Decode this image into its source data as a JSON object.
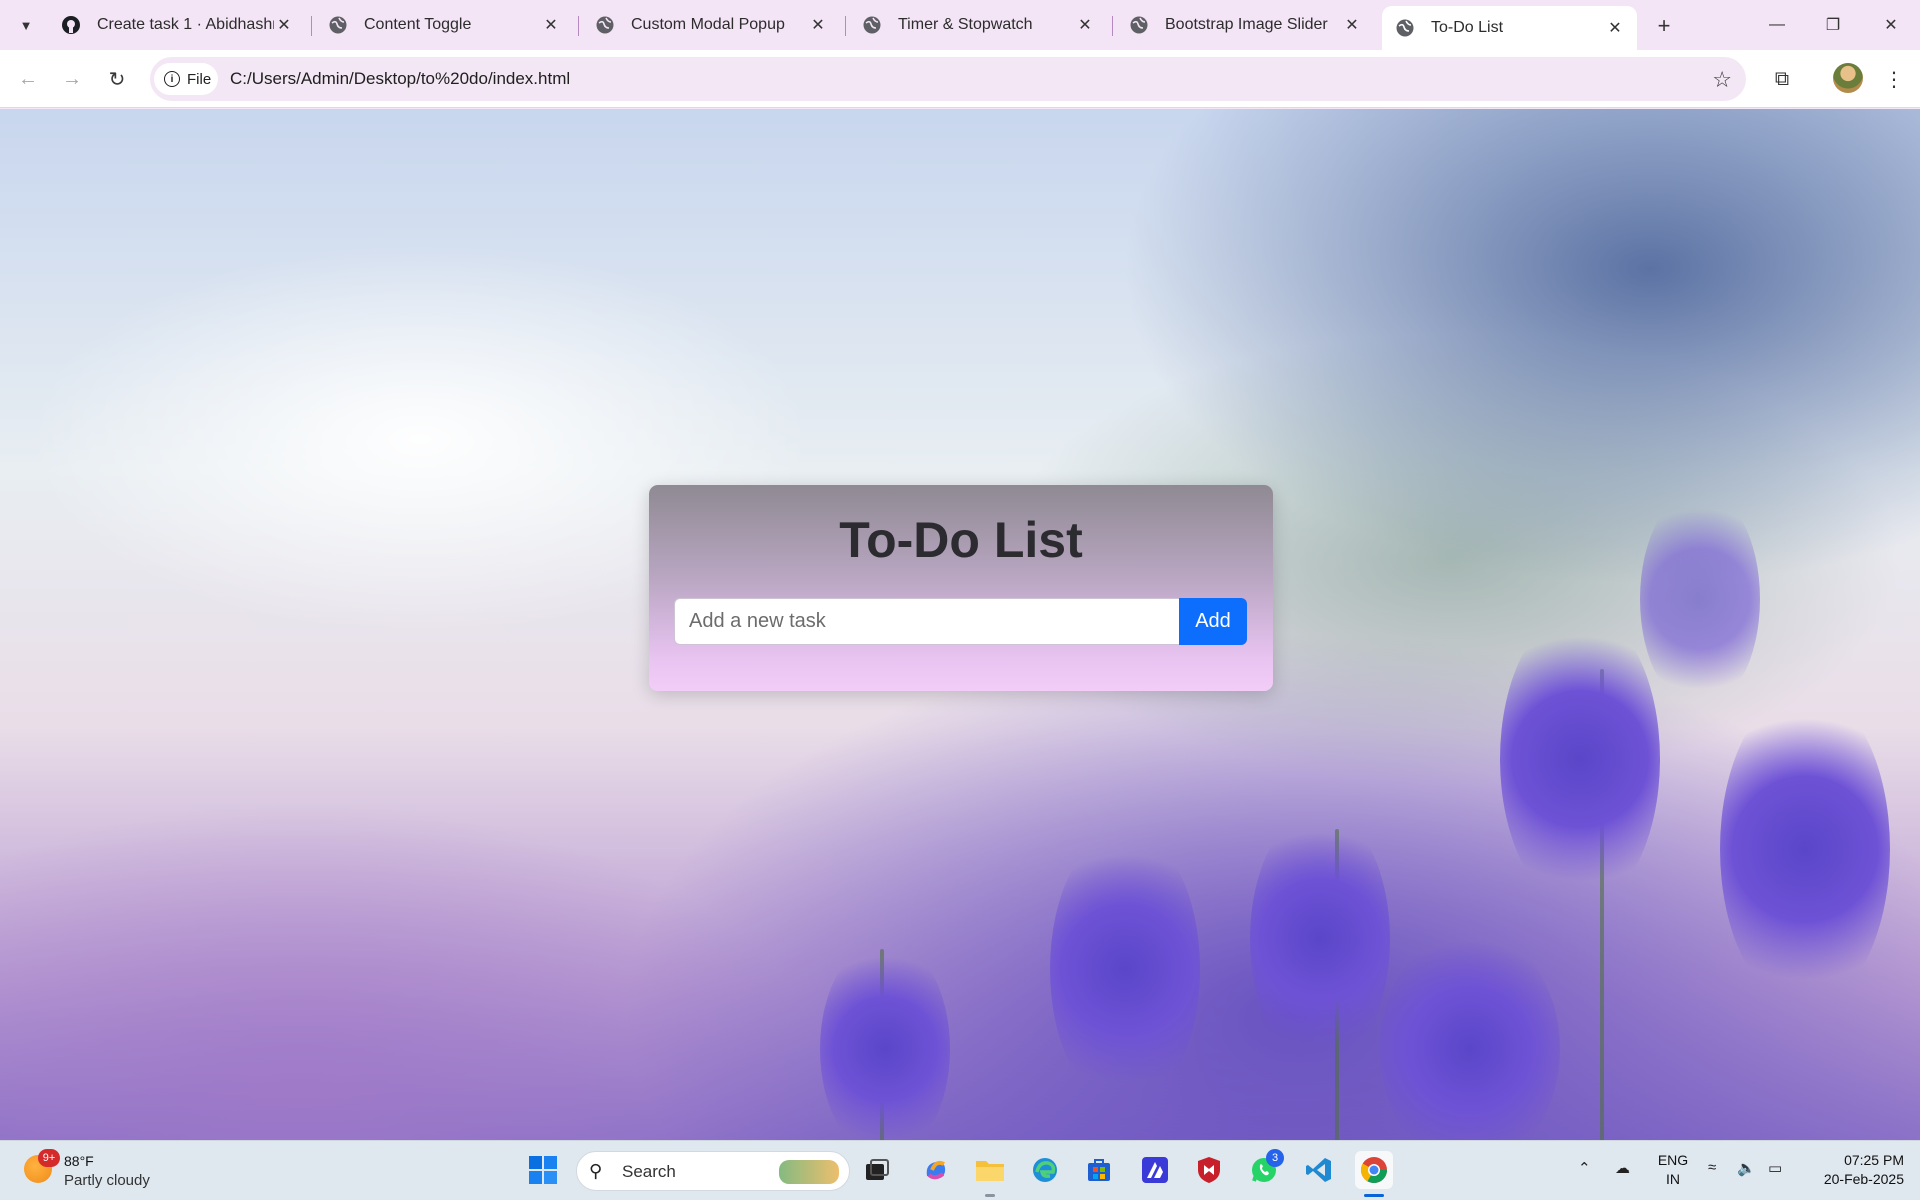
{
  "browser": {
    "tabs": [
      {
        "title": "Create task 1 · Abidhashree",
        "icon": "github-icon",
        "active": false
      },
      {
        "title": "Content Toggle",
        "icon": "globe-icon",
        "active": false
      },
      {
        "title": "Custom Modal Popup",
        "icon": "globe-icon",
        "active": false
      },
      {
        "title": "Timer & Stopwatch",
        "icon": "globe-icon",
        "active": false
      },
      {
        "title": "Bootstrap Image Slider",
        "icon": "globe-icon",
        "active": false
      },
      {
        "title": "To-Do List",
        "icon": "globe-icon",
        "active": true
      }
    ],
    "site_chip": "File",
    "url": "C:/Users/Admin/Desktop/to%20do/index.html"
  },
  "page": {
    "title": "To-Do List",
    "input_placeholder": "Add a new task",
    "input_value": "",
    "add_label": "Add",
    "accent": "#0d6efd"
  },
  "taskbar": {
    "weather": {
      "badge": "9+",
      "temp": "88°F",
      "condition": "Partly cloudy"
    },
    "search_label": "Search",
    "apps": [
      "start-icon",
      "task-view-icon",
      "copilot-icon",
      "file-explorer-icon",
      "edge-icon",
      "store-icon",
      "powerapps-icon",
      "mcafee-icon",
      "whatsapp-icon",
      "vscode-icon",
      "chrome-icon"
    ],
    "whatsapp_badge": "3",
    "language": {
      "line1": "ENG",
      "line2": "IN"
    },
    "clock": {
      "time": "07:25 PM",
      "date": "20-Feb-2025"
    }
  }
}
